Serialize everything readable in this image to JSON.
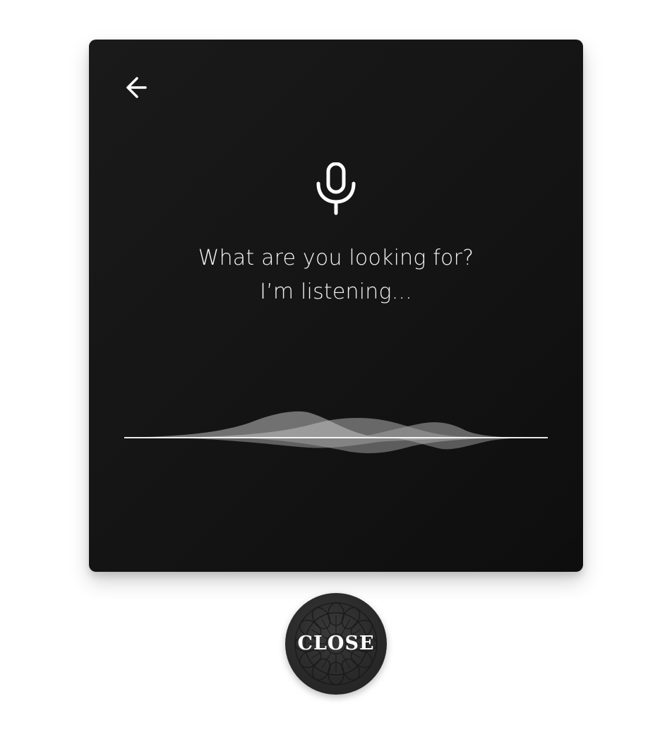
{
  "dialog": {
    "back_icon": "arrow-left-icon",
    "mic_icon": "microphone-icon",
    "prompt_line1": "What are you looking for?",
    "prompt_line2": "I’m listening...",
    "wave_icon": "voice-waveform"
  },
  "close_button": {
    "label": "CLOSE"
  },
  "colors": {
    "panel": "#151515",
    "text": "#f2f2f2",
    "close_button": "#2c2c2c"
  }
}
